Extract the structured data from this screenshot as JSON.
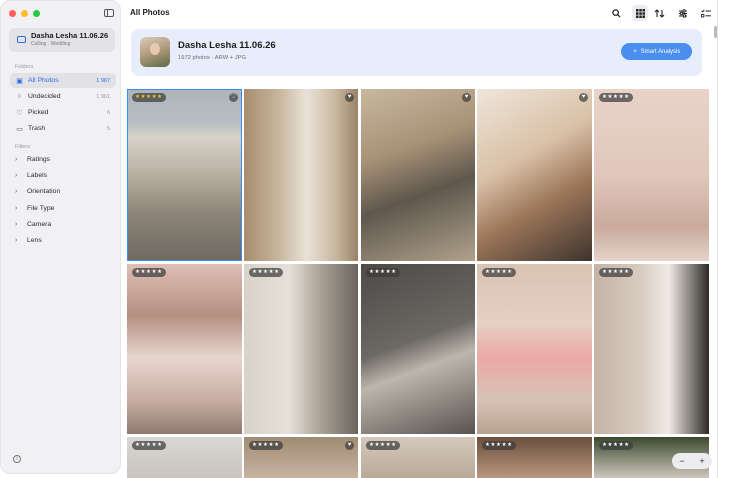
{
  "sidebar": {
    "project": {
      "title": "Dasha Lesha 11.06.26",
      "subtitle": "Culling · Wedding"
    },
    "folders_heading": "Folders",
    "folders": [
      {
        "label": "All Photos",
        "count": "1 967",
        "icon": "photos-icon",
        "glyph": "▣"
      },
      {
        "label": "Undecided",
        "count": "1 961",
        "icon": "circle-icon",
        "glyph": "○"
      },
      {
        "label": "Picked",
        "count": "6",
        "icon": "heart-icon",
        "glyph": "♡"
      },
      {
        "label": "Trash",
        "count": "5",
        "icon": "trash-icon",
        "glyph": "▭"
      }
    ],
    "filters_heading": "Filters",
    "filters": [
      "Ratings",
      "Labels",
      "Orientation",
      "File Type",
      "Camera",
      "Lens"
    ]
  },
  "header": {
    "title": "All Photos"
  },
  "banner": {
    "title": "Dasha Lesha 11.06.26",
    "subtitle": "1972 photos · ARW + JPG",
    "button_label": "Smart Analysis"
  },
  "toolbar": [
    "search-icon",
    "grid-view-icon",
    "sort-icon",
    "filter-sliders-icon",
    "checklist-icon"
  ],
  "photos": [
    {
      "stars": "★★★★★",
      "gold": true,
      "heart": "♡",
      "selected": true
    },
    {
      "stars": "",
      "heart": "♥"
    },
    {
      "stars": "",
      "heart": "♥"
    },
    {
      "stars": "",
      "heart": "♥"
    },
    {
      "stars": "★★★★★",
      "heart": ""
    },
    {
      "stars": "★★★★★",
      "heart": ""
    },
    {
      "stars": "★★★★★",
      "heart": ""
    },
    {
      "stars": "★★★★★",
      "heart": ""
    },
    {
      "stars": "★★★★★",
      "heart": ""
    },
    {
      "stars": "★★★★★",
      "heart": ""
    },
    {
      "stars": "★★★★★",
      "heart": ""
    },
    {
      "stars": "★★★★★",
      "heart": "♥"
    },
    {
      "stars": "★★★★★",
      "heart": ""
    },
    {
      "stars": "★★★★★",
      "heart": ""
    },
    {
      "stars": "★★★★★",
      "heart": ""
    }
  ],
  "zoom": {
    "minus": "−",
    "plus": "+"
  },
  "colors": {
    "accent": "#2a6de8",
    "button": "#4a8ff0",
    "banner": "#e7edfa",
    "sidebar": "#f1f1f4"
  }
}
